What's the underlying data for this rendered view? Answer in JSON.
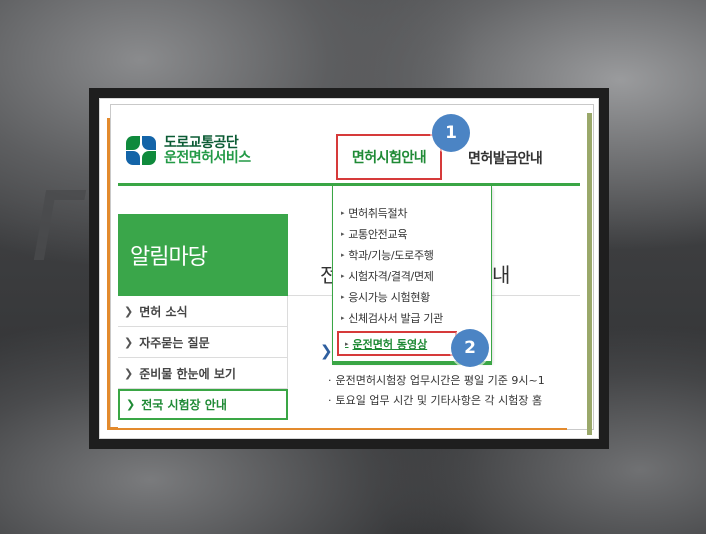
{
  "logo": {
    "line1": "도로교통공단",
    "line2": "운전면허서비스"
  },
  "nav": {
    "item1": "면허시험안내",
    "item2": "면허발급안내"
  },
  "badges": {
    "first": "1",
    "second": "2"
  },
  "dropdown": {
    "items": [
      "면허취득절차",
      "교통안전교육",
      "학과/기능/도로주행",
      "시험자격/결격/면제",
      "응시가능 시험현황",
      "신체검사서 발급 기관"
    ],
    "highlighted": "운전면허 동영상"
  },
  "sidebar": {
    "title": "알림마당",
    "items": [
      "면허 소식",
      "자주묻는 질문",
      "준비물 한눈에 보기",
      "전국 시험장 안내"
    ]
  },
  "main": {
    "heading_start": "전",
    "heading_end": "내",
    "info": [
      "운전면허시험장 업무시간은 평일 기준 9시~1",
      "토요일 업무 시간 및 기타사항은 각 시험장 홈"
    ]
  },
  "colors": {
    "brand_green": "#3aa645",
    "highlight_red": "#d63a3a",
    "badge_blue": "#4b84c4",
    "accent_orange": "#e38a2d"
  }
}
